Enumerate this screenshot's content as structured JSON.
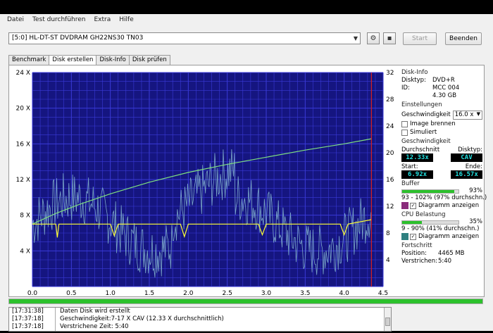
{
  "menu": [
    "Datei",
    "Test durchführen",
    "Extra",
    "Hilfe"
  ],
  "toolbar": {
    "drive": "[5:0] HL-DT-ST DVDRAM GH22NS30 TN03",
    "start_label": "Start",
    "exit_label": "Beenden"
  },
  "tabs": [
    "Benchmark",
    "Disk erstellen",
    "Disk-Info",
    "Disk prüfen"
  ],
  "active_tab": 1,
  "sidebar": {
    "disk_info_title": "Disk-Info",
    "disk_type_label": "Disktyp:",
    "disk_type_value": "DVD+R",
    "id_label": "ID:",
    "id_value": "MCC 004",
    "size_label": "",
    "size_value": "4.30 GB",
    "settings_title": "Einstellungen",
    "speed_label": "Geschwindigkeit",
    "speed_value": "16.0 x",
    "image_burn_label": "Image brennen",
    "simulate_label": "Simuliert",
    "speed_title": "Geschwindigkeit",
    "avg_label": "Durchschnitt",
    "disktype_label": "Disktyp:",
    "avg_value": "12.33x",
    "cav_value": "CAV",
    "start_label": "Start:",
    "end_label": "Ende:",
    "start_value": "6.92x",
    "end_value": "16.57x",
    "buffer_title": "Buffer",
    "buffer_pct": "93%",
    "buffer_fraction": 0.93,
    "buffer_range": "93 - 102% (97% durchschn.)",
    "buffer_diag_label": "Diagramm anzeigen",
    "cpu_title": "CPU Belastung",
    "cpu_pct": "35%",
    "cpu_fraction": 0.35,
    "cpu_range": "9 - 90% (41% durchschn.)",
    "cpu_diag_label": "Diagramm anzeigen",
    "progress_title": "Fortschritt",
    "position_label": "Position:",
    "position_value": "4465 MB",
    "elapsed_label": "Verstrichen:",
    "elapsed_value": "5:40"
  },
  "progress_fraction": 1.0,
  "log": [
    {
      "time": "[17:31:38]",
      "text": "Daten Disk wird erstellt"
    },
    {
      "time": "[17:37:18]",
      "text": "Geschwindigkeit:7-17 X CAV (12.33 X durchschnittlich)"
    },
    {
      "time": "[17:37:18]",
      "text": "Verstrichene Zeit: 5:40"
    }
  ],
  "colors": {
    "plot_bg": "#151580",
    "grid": "#3a3ad8",
    "speed_line": "#7fe07f",
    "read_noise": "#7aa6c8",
    "buffer_line": "#ffff33",
    "end_marker": "#d62020",
    "buffer_swatch": "#8a2b7b",
    "cpu_swatch": "#2f8080"
  },
  "chart_data": {
    "type": "line",
    "xlim": [
      0,
      4.5
    ],
    "ylim_left": [
      0,
      24
    ],
    "ylim_right": [
      0,
      32
    ],
    "x_ticks": [
      "0.0",
      "0.5",
      "1.0",
      "1.5",
      "2.0",
      "2.5",
      "3.0",
      "3.5",
      "4.0",
      "4.5"
    ],
    "y_ticks_left": [
      "4 X",
      "8 X",
      "12 X",
      "16 X",
      "20 X",
      "24 X"
    ],
    "y_ticks_right": [
      "4",
      "8",
      "12",
      "16",
      "20",
      "24",
      "28",
      "32"
    ],
    "end_x": 4.35,
    "series": [
      {
        "key": "speed",
        "x": [
          0.0,
          0.3,
          0.6,
          1.0,
          1.5,
          2.0,
          2.5,
          3.0,
          3.5,
          4.0,
          4.35
        ],
        "y": [
          7.0,
          8.2,
          9.2,
          10.4,
          11.7,
          12.8,
          13.7,
          14.5,
          15.3,
          16.0,
          16.57
        ]
      },
      {
        "key": "buffer",
        "x": [
          0.0,
          0.3,
          0.32,
          0.34,
          1.0,
          1.05,
          1.1,
          1.9,
          1.95,
          2.0,
          2.9,
          2.95,
          3.0,
          3.95,
          4.0,
          4.05,
          4.35
        ],
        "y": [
          7.0,
          7.0,
          5.5,
          7.0,
          7.0,
          5.7,
          7.0,
          7.0,
          5.6,
          7.0,
          7.0,
          5.8,
          7.0,
          7.0,
          5.8,
          7.0,
          7.5
        ]
      }
    ]
  }
}
